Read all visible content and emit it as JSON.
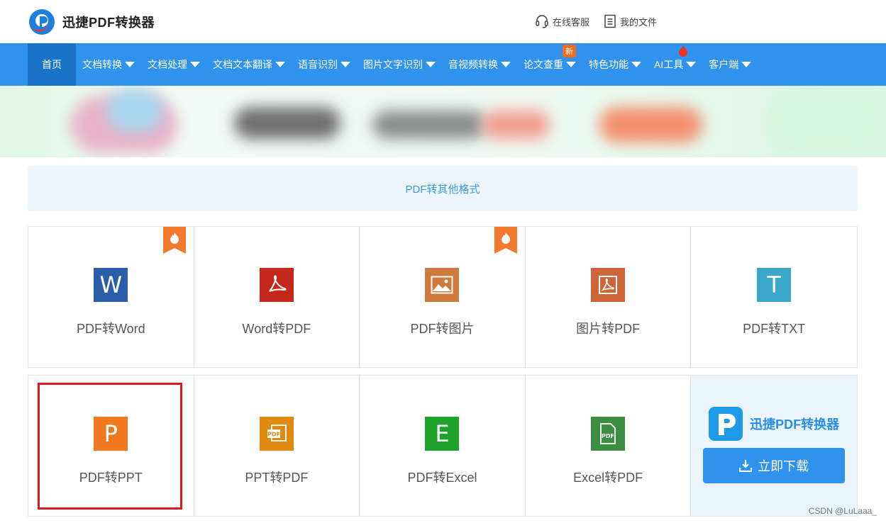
{
  "header": {
    "brand": "迅捷PDF转换器",
    "links": [
      {
        "icon": "headset-icon",
        "label": "在线客服"
      },
      {
        "icon": "file-list-icon",
        "label": "我的文件"
      }
    ]
  },
  "nav": {
    "items": [
      {
        "label": "首页",
        "active": true,
        "dropdown": false
      },
      {
        "label": "文档转换",
        "dropdown": true
      },
      {
        "label": "文档处理",
        "dropdown": true
      },
      {
        "label": "文档文本翻译",
        "dropdown": true
      },
      {
        "label": "语音识别",
        "dropdown": true
      },
      {
        "label": "图片文字识别",
        "dropdown": true
      },
      {
        "label": "音视频转换",
        "dropdown": true
      },
      {
        "label": "论文查重",
        "dropdown": true,
        "badge": "新"
      },
      {
        "label": "特色功能",
        "dropdown": true
      },
      {
        "label": "AI工具",
        "dropdown": true,
        "flame": true
      },
      {
        "label": "客户端",
        "dropdown": true
      }
    ]
  },
  "section": {
    "title": "PDF转其他格式"
  },
  "tools": {
    "row1": [
      {
        "label": "PDF转Word",
        "icon": "word-icon",
        "glyph": "W",
        "color": "#2a5ea9",
        "hot": true
      },
      {
        "label": "Word转PDF",
        "icon": "pdf-acrobat-icon",
        "glyph": "",
        "color": "#c4281c",
        "hot": false
      },
      {
        "label": "PDF转图片",
        "icon": "image-icon",
        "glyph": "",
        "color": "#cf7a3c",
        "hot": true
      },
      {
        "label": "图片转PDF",
        "icon": "image-pdf-icon",
        "glyph": "",
        "color": "#cf6439",
        "hot": false
      },
      {
        "label": "PDF转TXT",
        "icon": "text-icon",
        "glyph": "T",
        "color": "#3aa6c9",
        "hot": false
      }
    ],
    "row2": [
      {
        "label": "PDF转PPT",
        "icon": "ppt-icon",
        "glyph": "P",
        "color": "#f0781e",
        "selected": true
      },
      {
        "label": "PPT转PDF",
        "icon": "ppt-pdf-icon",
        "glyph": "",
        "color": "#e08a12"
      },
      {
        "label": "PDF转Excel",
        "icon": "excel-icon",
        "glyph": "E",
        "color": "#1fa22b"
      },
      {
        "label": "Excel转PDF",
        "icon": "excel-pdf-icon",
        "glyph": "",
        "color": "#3d8d43"
      }
    ]
  },
  "promo": {
    "title": "迅捷PDF转换器",
    "button": "立即下载",
    "icon": "download-icon"
  },
  "watermark": "CSDN @LuLaaa_"
}
